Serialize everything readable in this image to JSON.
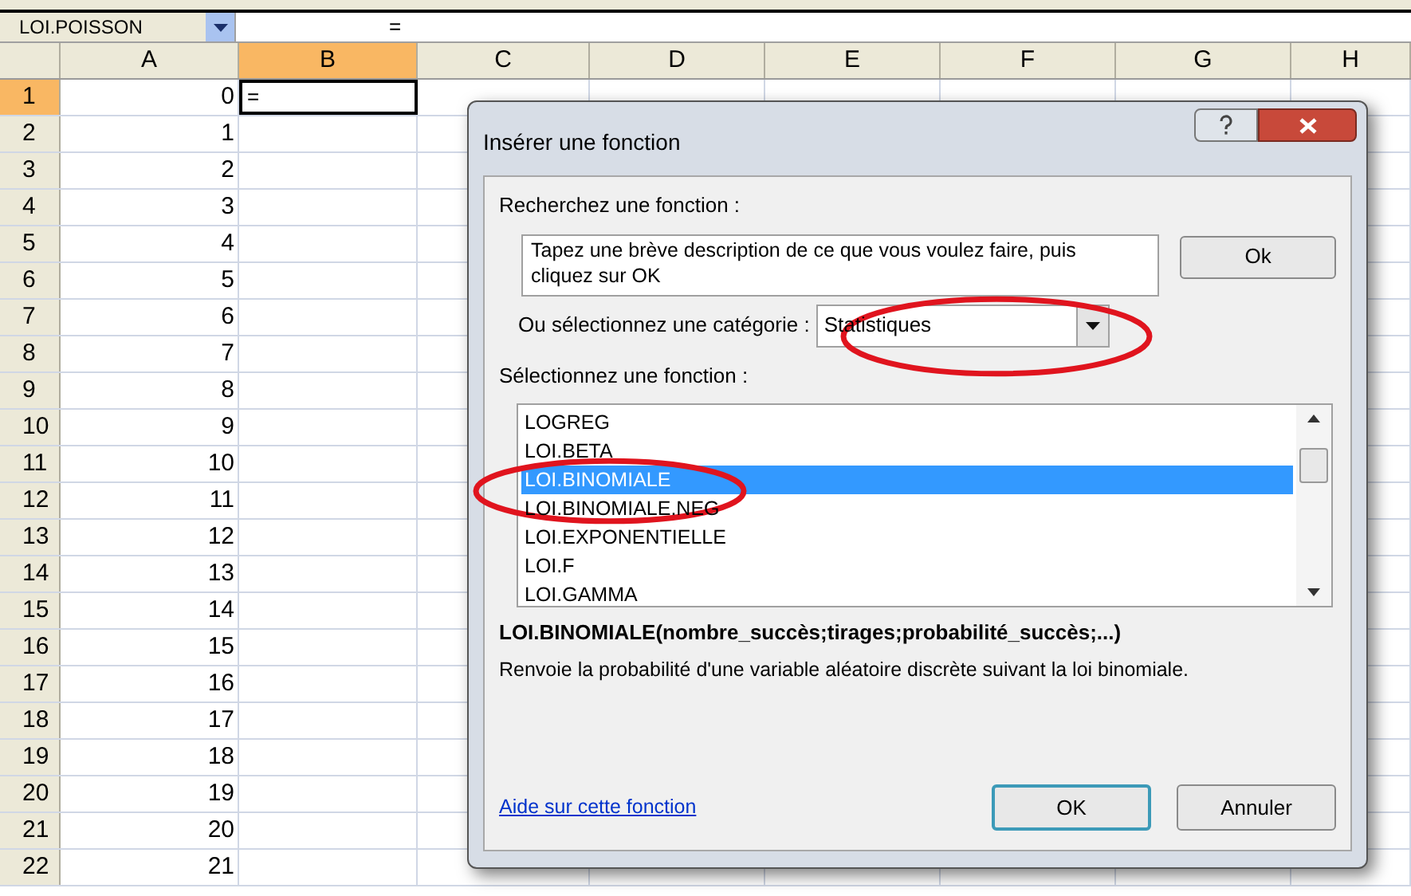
{
  "name_box": {
    "value": "LOI.POISSON"
  },
  "formula_bar": {
    "value": "="
  },
  "columns": [
    {
      "label": "A",
      "selected": false
    },
    {
      "label": "B",
      "selected": true
    },
    {
      "label": "C",
      "selected": false
    },
    {
      "label": "D",
      "selected": false
    },
    {
      "label": "E",
      "selected": false
    },
    {
      "label": "F",
      "selected": false
    },
    {
      "label": "G",
      "selected": false
    },
    {
      "label": "H",
      "selected": false
    }
  ],
  "rows": [
    {
      "header": "1",
      "selected": true,
      "cells": [
        "0",
        "="
      ]
    },
    {
      "header": "2",
      "selected": false,
      "cells": [
        "1"
      ]
    },
    {
      "header": "3",
      "selected": false,
      "cells": [
        "2"
      ]
    },
    {
      "header": "4",
      "selected": false,
      "cells": [
        "3"
      ]
    },
    {
      "header": "5",
      "selected": false,
      "cells": [
        "4"
      ]
    },
    {
      "header": "6",
      "selected": false,
      "cells": [
        "5"
      ]
    },
    {
      "header": "7",
      "selected": false,
      "cells": [
        "6"
      ]
    },
    {
      "header": "8",
      "selected": false,
      "cells": [
        "7"
      ]
    },
    {
      "header": "9",
      "selected": false,
      "cells": [
        "8"
      ]
    },
    {
      "header": "10",
      "selected": false,
      "cells": [
        "9"
      ]
    },
    {
      "header": "11",
      "selected": false,
      "cells": [
        "10"
      ]
    },
    {
      "header": "12",
      "selected": false,
      "cells": [
        "11"
      ]
    },
    {
      "header": "13",
      "selected": false,
      "cells": [
        "12"
      ]
    },
    {
      "header": "14",
      "selected": false,
      "cells": [
        "13"
      ]
    },
    {
      "header": "15",
      "selected": false,
      "cells": [
        "14"
      ]
    },
    {
      "header": "16",
      "selected": false,
      "cells": [
        "15"
      ]
    },
    {
      "header": "17",
      "selected": false,
      "cells": [
        "16"
      ]
    },
    {
      "header": "18",
      "selected": false,
      "cells": [
        "17"
      ]
    },
    {
      "header": "19",
      "selected": false,
      "cells": [
        "18"
      ]
    },
    {
      "header": "20",
      "selected": false,
      "cells": [
        "19"
      ]
    },
    {
      "header": "21",
      "selected": false,
      "cells": [
        "20"
      ]
    },
    {
      "header": "22",
      "selected": false,
      "cells": [
        "21"
      ]
    }
  ],
  "dialog": {
    "title": "Insérer une fonction",
    "search_label": "Recherchez une fonction :",
    "search_field": {
      "value": "Tapez une brève description de ce que vous voulez faire, puis cliquez sur OK"
    },
    "search_button": "Ok",
    "category_label": "Ou sélectionnez une catégorie :",
    "category": {
      "value": "Statistiques"
    },
    "function_label": "Sélectionnez une fonction :",
    "functions": [
      {
        "label": "LOGREG",
        "selected": false
      },
      {
        "label": "LOI.BETA",
        "selected": false
      },
      {
        "label": "LOI.BINOMIALE",
        "selected": true
      },
      {
        "label": "LOI.BINOMIALE.NEG",
        "selected": false
      },
      {
        "label": "LOI.EXPONENTIELLE",
        "selected": false
      },
      {
        "label": "LOI.F",
        "selected": false
      },
      {
        "label": "LOI.GAMMA",
        "selected": false
      }
    ],
    "signature": "LOI.BINOMIALE(nombre_succès;tirages;probabilité_succès;...)",
    "description": "Renvoie la probabilité d'une variable aléatoire discrète suivant la loi binomiale.",
    "help_link": "Aide sur cette fonction",
    "buttons": [
      {
        "label": "OK",
        "default": true
      },
      {
        "label": "Annuler",
        "default": false
      }
    ]
  },
  "annotations": [
    {
      "kind": "ellipse"
    },
    {
      "kind": "ellipse"
    }
  ]
}
